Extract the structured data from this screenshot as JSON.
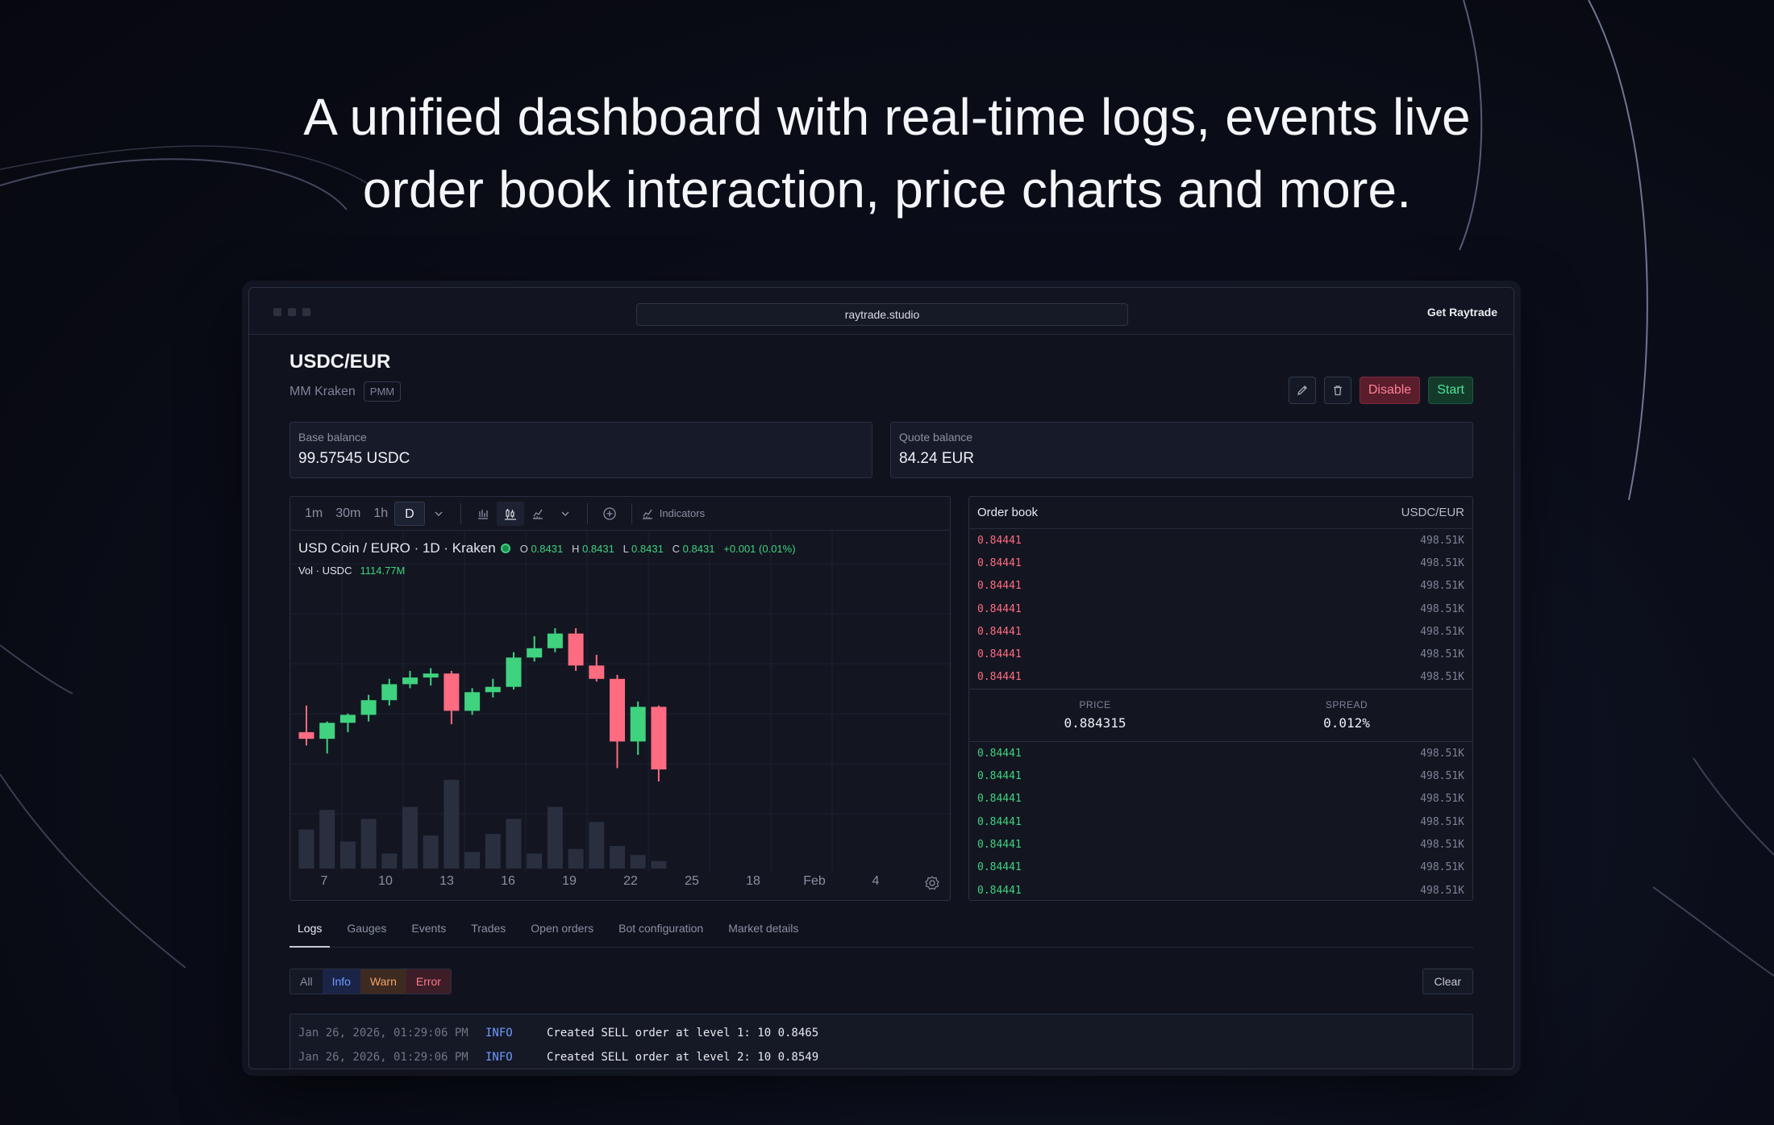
{
  "headline": {
    "line1": "A unified dashboard with real-time logs, events live",
    "line2": "order book interaction, price charts and more."
  },
  "browser": {
    "url": "raytrade.studio",
    "cta": "Get Raytrade"
  },
  "bot": {
    "pair": "USDC/EUR",
    "name": "MM Kraken",
    "tag": "PMM",
    "actions": {
      "edit_icon": "pencil-icon",
      "delete_icon": "trash-icon",
      "disable": "Disable",
      "start": "Start"
    }
  },
  "balances": {
    "base": {
      "label": "Base balance",
      "value": "99.57545 USDC"
    },
    "quote": {
      "label": "Quote balance",
      "value": "84.24 EUR"
    }
  },
  "chart_toolbar": {
    "timeframes": [
      "1m",
      "30m",
      "1h",
      "D"
    ],
    "active_timeframe": "D",
    "indicators": "Indicators"
  },
  "chart_legend": {
    "symbol": "USD Coin / EURO · 1D · Kraken",
    "o_label": "O",
    "o": "0.8431",
    "h_label": "H",
    "h": "0.8431",
    "l_label": "L",
    "l": "0.8431",
    "c_label": "C",
    "c": "0.8431",
    "change": "+0.001 (0.01%)",
    "vol_label": "Vol · USDC",
    "vol": "1114.77M"
  },
  "chart_data": {
    "type": "candlestick",
    "x_tick_labels": [
      "7",
      "10",
      "13",
      "16",
      "19",
      "22",
      "25",
      "18",
      "Feb",
      "4"
    ],
    "candles": [
      {
        "o": 0.8412,
        "h": 0.8432,
        "l": 0.8402,
        "c": 0.8407
      },
      {
        "o": 0.8407,
        "h": 0.842,
        "l": 0.8396,
        "c": 0.8419
      },
      {
        "o": 0.8419,
        "h": 0.8426,
        "l": 0.8412,
        "c": 0.8425
      },
      {
        "o": 0.8425,
        "h": 0.844,
        "l": 0.842,
        "c": 0.8436
      },
      {
        "o": 0.8436,
        "h": 0.8452,
        "l": 0.8432,
        "c": 0.8448
      },
      {
        "o": 0.8448,
        "h": 0.8458,
        "l": 0.8445,
        "c": 0.8453
      },
      {
        "o": 0.8453,
        "h": 0.846,
        "l": 0.8447,
        "c": 0.8456
      },
      {
        "o": 0.8456,
        "h": 0.8458,
        "l": 0.8418,
        "c": 0.8428
      },
      {
        "o": 0.8428,
        "h": 0.8445,
        "l": 0.8425,
        "c": 0.8442
      },
      {
        "o": 0.8442,
        "h": 0.8452,
        "l": 0.8438,
        "c": 0.8446
      },
      {
        "o": 0.8446,
        "h": 0.8472,
        "l": 0.8444,
        "c": 0.8468
      },
      {
        "o": 0.8468,
        "h": 0.8484,
        "l": 0.8465,
        "c": 0.8475
      },
      {
        "o": 0.8475,
        "h": 0.849,
        "l": 0.8472,
        "c": 0.8486
      },
      {
        "o": 0.8486,
        "h": 0.849,
        "l": 0.8458,
        "c": 0.8462
      },
      {
        "o": 0.8462,
        "h": 0.847,
        "l": 0.845,
        "c": 0.8452
      },
      {
        "o": 0.8452,
        "h": 0.8455,
        "l": 0.8385,
        "c": 0.8405
      },
      {
        "o": 0.8405,
        "h": 0.8435,
        "l": 0.8395,
        "c": 0.8431
      },
      {
        "o": 0.8431,
        "h": 0.8432,
        "l": 0.8375,
        "c": 0.8384
      }
    ],
    "volume": [
      52,
      78,
      36,
      66,
      20,
      82,
      44,
      118,
      22,
      46,
      66,
      20,
      82,
      26,
      62,
      30,
      18,
      10
    ]
  },
  "orderbook": {
    "title": "Order book",
    "pair": "USDC/EUR",
    "asks": [
      {
        "price": "0.84441",
        "size": "498.51K"
      },
      {
        "price": "0.84441",
        "size": "498.51K"
      },
      {
        "price": "0.84441",
        "size": "498.51K"
      },
      {
        "price": "0.84441",
        "size": "498.51K"
      },
      {
        "price": "0.84441",
        "size": "498.51K"
      },
      {
        "price": "0.84441",
        "size": "498.51K"
      },
      {
        "price": "0.84441",
        "size": "498.51K"
      }
    ],
    "price_label": "PRICE",
    "price": "0.884315",
    "spread_label": "SPREAD",
    "spread": "0.012%",
    "bids": [
      {
        "price": "0.84441",
        "size": "498.51K"
      },
      {
        "price": "0.84441",
        "size": "498.51K"
      },
      {
        "price": "0.84441",
        "size": "498.51K"
      },
      {
        "price": "0.84441",
        "size": "498.51K"
      },
      {
        "price": "0.84441",
        "size": "498.51K"
      },
      {
        "price": "0.84441",
        "size": "498.51K"
      },
      {
        "price": "0.84441",
        "size": "498.51K"
      }
    ]
  },
  "tabs": [
    "Logs",
    "Gauges",
    "Events",
    "Trades",
    "Open orders",
    "Bot configuration",
    "Market details"
  ],
  "active_tab": "Logs",
  "log_filters": {
    "all": "All",
    "info": "Info",
    "warn": "Warn",
    "error": "Error",
    "clear": "Clear"
  },
  "logs": [
    {
      "time": "Jan 26, 2026, 01:29:06 PM",
      "level": "INFO",
      "message": "Created SELL order at level 1: 10 0.8465"
    },
    {
      "time": "Jan 26, 2026, 01:29:06 PM",
      "level": "INFO",
      "message": "Created SELL order at level 2: 10 0.8549"
    }
  ],
  "colors": {
    "up": "#3fd27f",
    "down": "#ff6b80",
    "volume": "#2a2f3f"
  }
}
